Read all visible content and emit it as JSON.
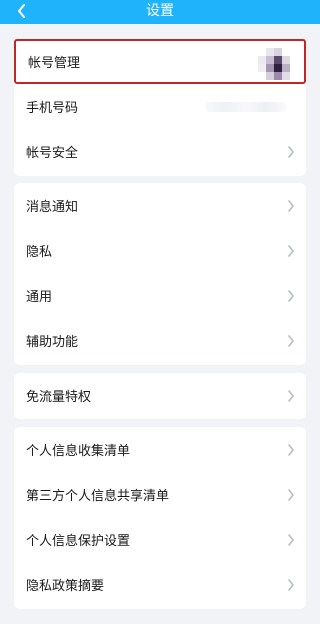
{
  "header": {
    "title": "设置",
    "back_icon": "chevron-left-icon"
  },
  "groups": [
    {
      "items": [
        {
          "label": "帐号管理",
          "has_avatar": true
        },
        {
          "label": "手机号码"
        },
        {
          "label": "帐号安全"
        }
      ]
    },
    {
      "items": [
        {
          "label": "消息通知"
        },
        {
          "label": "隐私"
        },
        {
          "label": "通用"
        },
        {
          "label": "辅助功能"
        }
      ]
    },
    {
      "items": [
        {
          "label": "免流量特权"
        }
      ]
    },
    {
      "items": [
        {
          "label": "个人信息收集清单"
        },
        {
          "label": "第三方个人信息共享清单"
        },
        {
          "label": "个人信息保护设置"
        },
        {
          "label": "隐私政策摘要"
        }
      ]
    }
  ],
  "colors": {
    "header_bg": "#1fb3fb",
    "highlight_border": "#c02828",
    "page_bg": "#f2f3f7"
  }
}
